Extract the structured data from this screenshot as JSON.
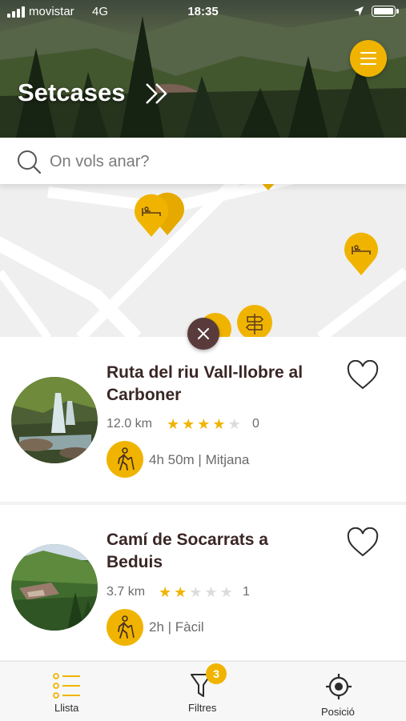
{
  "status_bar": {
    "carrier": "movistar",
    "network": "4G",
    "time": "18:35"
  },
  "header": {
    "title": "Setcases"
  },
  "search": {
    "placeholder": "On vols anar?"
  },
  "routes": [
    {
      "title": "Ruta del riu Vall-llobre al Carboner",
      "distance": "12.0 km",
      "rating": 4,
      "max_rating": 5,
      "reviews": "0",
      "duration": "4h 50m | Mitjana",
      "icon": "hiker-icon"
    },
    {
      "title": "Camí de Socarrats a Beduis",
      "distance": "3.7 km",
      "rating": 2,
      "max_rating": 5,
      "reviews": "1",
      "duration": "2h | Fàcil",
      "icon": "hiker-icon"
    }
  ],
  "tabbar": {
    "list_label": "Llista",
    "filters_label": "Filtres",
    "filters_count": "3",
    "position_label": "Posició"
  },
  "colors": {
    "accent": "#f0b400",
    "title": "#3a2626",
    "close_button": "#5a3b3b"
  }
}
